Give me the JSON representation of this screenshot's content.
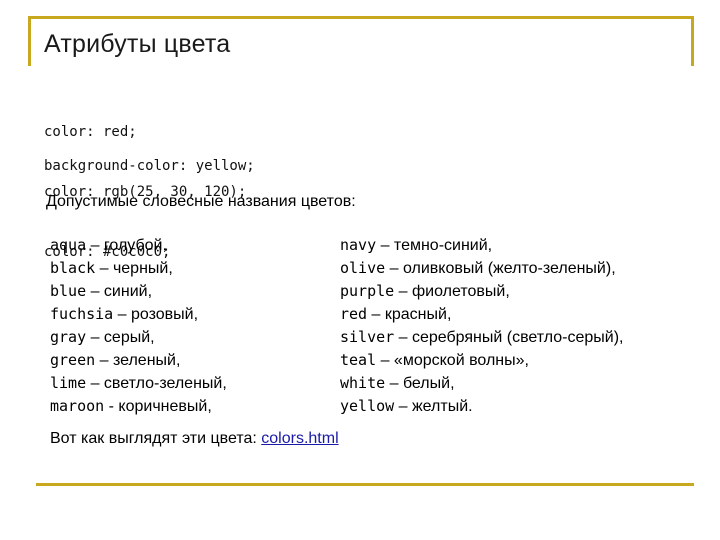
{
  "slide": {
    "title": "Атрибуты цвета",
    "code_lines": [
      "color: red;",
      "color: rgb(25, 30, 120);",
      "color: #c0c0c0;"
    ],
    "code_bg": "background-color: yellow;",
    "subtitle": "Допустимые словесные названия цветов:",
    "colors_left": [
      {
        "name": "aqua",
        "desc": " – голубой,"
      },
      {
        "name": "black",
        "desc": " – черный,"
      },
      {
        "name": "blue",
        "desc": " – синий,"
      },
      {
        "name": "fuchsia",
        "desc": " – розовый,"
      },
      {
        "name": "gray",
        "desc": " – серый,"
      },
      {
        "name": "green",
        "desc": " – зеленый,"
      },
      {
        "name": "lime",
        "desc": " – светло-зеленый,"
      },
      {
        "name": "maroon",
        "desc": " - коричневый,"
      }
    ],
    "colors_right": [
      {
        "name": "navy",
        "desc": " – темно-синий,"
      },
      {
        "name": "olive",
        "desc": " – оливковый (желто-зеленый),"
      },
      {
        "name": "purple",
        "desc": " – фиолетовый,"
      },
      {
        "name": "red",
        "desc": " – красный,"
      },
      {
        "name": "silver",
        "desc": " – серебряный (светло-серый),"
      },
      {
        "name": "teal",
        "desc": " – «морской волны»,"
      },
      {
        "name": "white",
        "desc": " – белый,"
      },
      {
        "name": "yellow",
        "desc": " – желтый."
      }
    ],
    "footer_text": "Вот как выглядят эти цвета: ",
    "footer_link": "colors.html"
  },
  "colors": {
    "accent_rule": "#c8a81e",
    "link": "#1a1aa6"
  }
}
